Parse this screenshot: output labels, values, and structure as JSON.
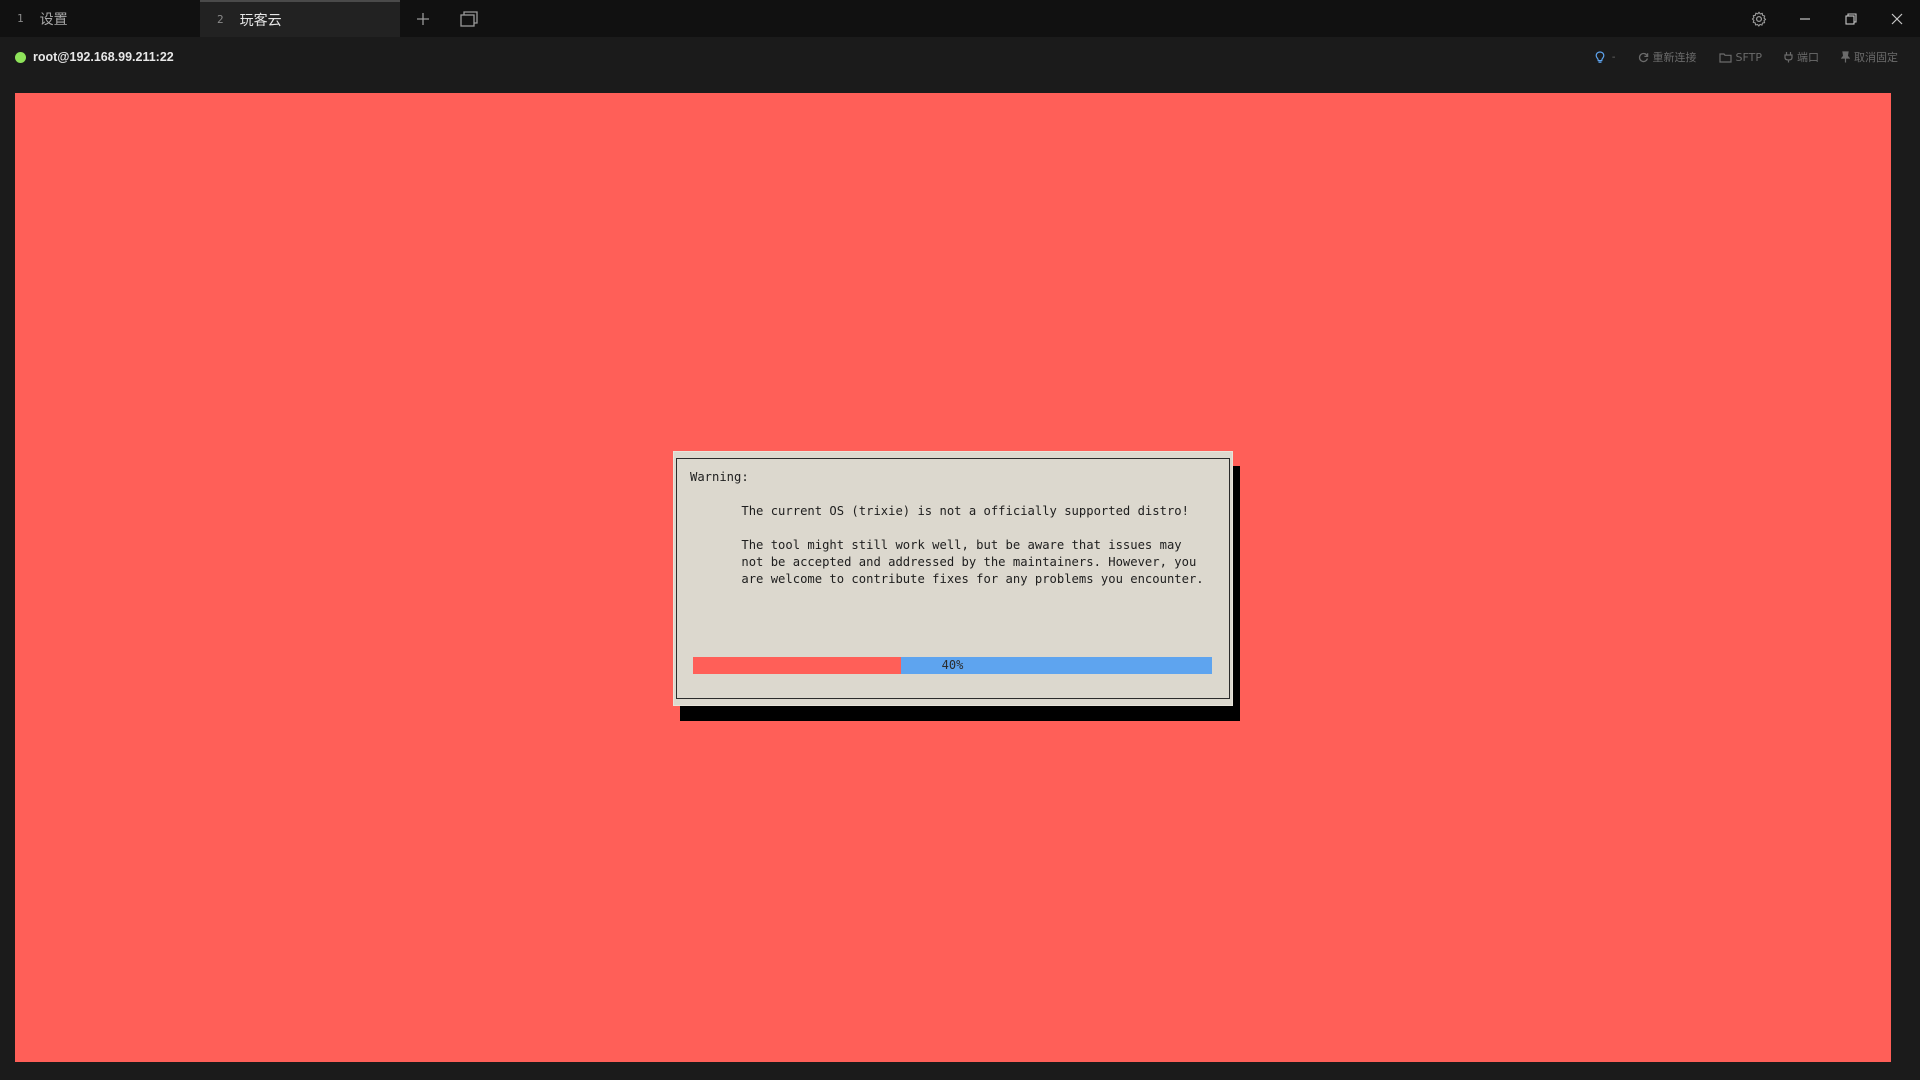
{
  "tabs": [
    {
      "number": "1",
      "label": "设置",
      "active": false
    },
    {
      "number": "2",
      "label": "玩客云",
      "active": true
    }
  ],
  "session": {
    "status_color": "#8ee35a",
    "host": "root@192.168.99.211:22",
    "actions": {
      "hint_caret": "-",
      "reconnect": "重新连接",
      "sftp": "SFTP",
      "port": "端口",
      "unpin": "取消固定"
    }
  },
  "terminal": {
    "background": "#ff5f58",
    "dialog": {
      "title": "Warning:",
      "line1": "The current OS (trixie) is not a officially supported distro!",
      "para2": [
        "The tool might still work well, but be aware that issues may",
        "not be accepted and addressed by the maintainers. However, you",
        "are welcome to contribute fixes for any problems you encounter."
      ],
      "progress_percent": 40,
      "progress_label": "40%"
    }
  },
  "icons": {
    "new_tab": "plus-icon",
    "tab_overview": "windows-icon",
    "settings": "gear-icon",
    "minimize": "minimize-icon",
    "restore": "restore-icon",
    "close": "close-icon"
  }
}
